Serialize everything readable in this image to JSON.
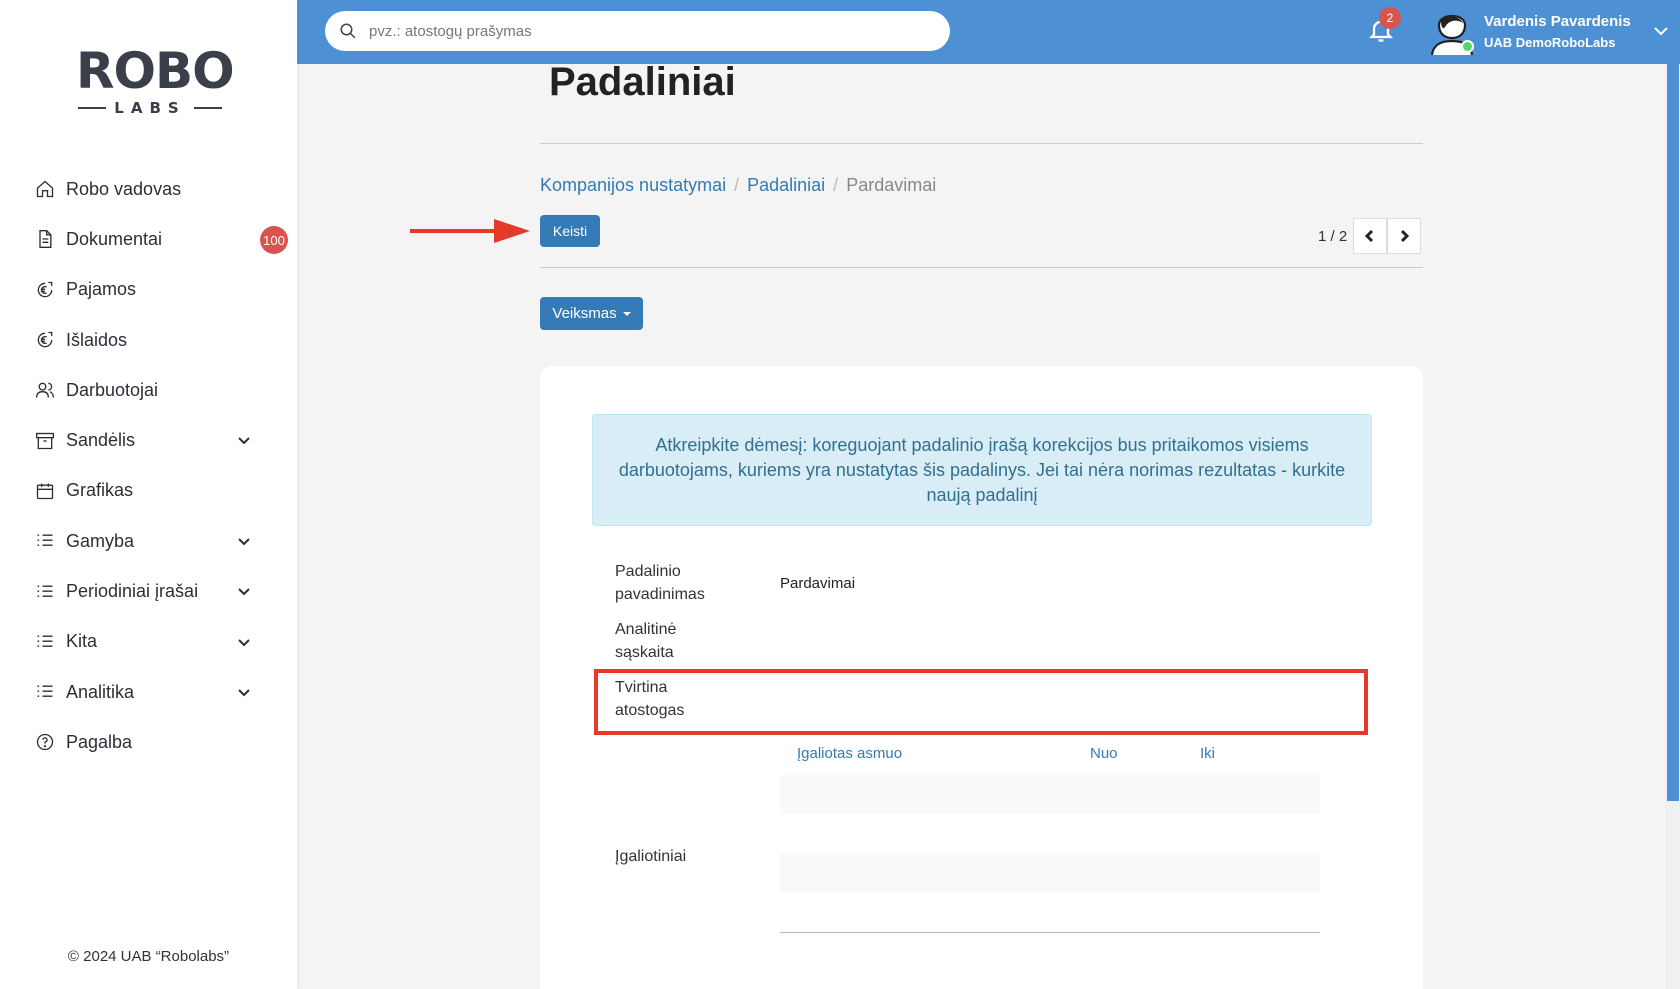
{
  "sidebar": {
    "logo_main": "ROBO",
    "logo_sub": "LABS",
    "items": [
      {
        "label": "Robo vadovas",
        "icon": "home-icon"
      },
      {
        "label": "Dokumentai",
        "icon": "document-icon",
        "badge": "100"
      },
      {
        "label": "Pajamos",
        "icon": "euro-circle-icon"
      },
      {
        "label": "Išlaidos",
        "icon": "euro-circle-icon"
      },
      {
        "label": "Darbuotojai",
        "icon": "users-icon"
      },
      {
        "label": "Sandėlis",
        "icon": "archive-icon",
        "expandable": true
      },
      {
        "label": "Grafikas",
        "icon": "calendar-icon"
      },
      {
        "label": "Gamyba",
        "icon": "list-icon",
        "expandable": true
      },
      {
        "label": "Periodiniai įrašai",
        "icon": "list-icon",
        "expandable": true
      },
      {
        "label": "Kita",
        "icon": "list-icon",
        "expandable": true
      },
      {
        "label": "Analitika",
        "icon": "list-icon",
        "expandable": true
      },
      {
        "label": "Pagalba",
        "icon": "help-circle-icon"
      }
    ],
    "copyright": "© 2024 UAB “Robolabs”"
  },
  "header": {
    "search_placeholder": "pvz.: atostogų prašymas",
    "notifications_count": "2",
    "user_name": "Vardenis Pavardenis",
    "user_company": "UAB DemoRoboLabs"
  },
  "main": {
    "title": "Padaliniai",
    "breadcrumb": [
      "Kompanijos nustatymai",
      "Padaliniai",
      "Pardavimai"
    ],
    "edit_button": "Keisti",
    "pager": "1 / 2",
    "action_button": "Veiksmas",
    "alert": "Atkreipkite dėmesį: koreguojant padalinio įrašą korekcijos bus pritaikomos visiems darbuotojams, kuriems yra nustatytas šis padalinys. Jei tai nėra norimas rezultatas - kurkite naują padalinį",
    "fields": {
      "name_label": "Padalinio pavadinimas",
      "name_value": "Pardavimai",
      "account_label": "Analitinė sąskaita",
      "approves_label": "Tvirtina atostogas",
      "authorizations_label": "Įgaliotiniai"
    },
    "table": {
      "columns": [
        "Įgaliotas asmuo",
        "Nuo",
        "Iki"
      ]
    }
  },
  "colors": {
    "header_bg": "#4d90d4",
    "primary": "#337ab7",
    "badge": "#d9534f",
    "highlight": "#e53a2a",
    "alert_bg": "#d9edf7"
  }
}
